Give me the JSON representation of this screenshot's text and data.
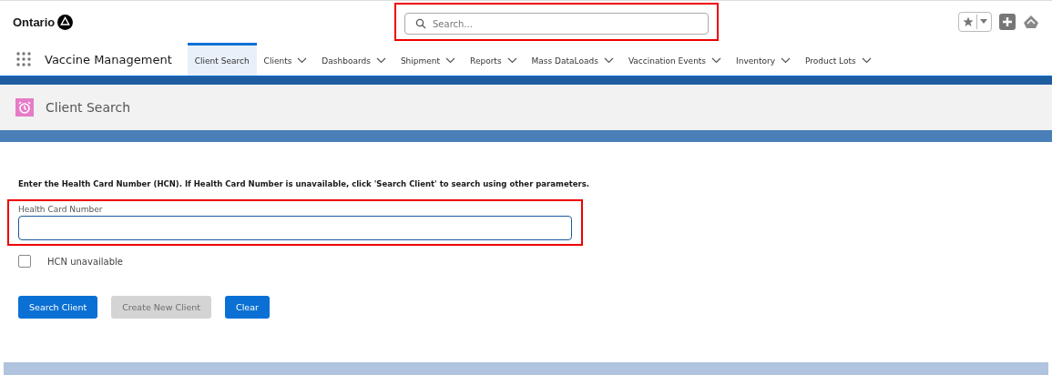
{
  "header": {
    "logo": "Ontario",
    "search": {
      "placeholder": "Search...",
      "highlighted": true
    }
  },
  "nav": {
    "app_name": "Vaccine Management",
    "tabs": [
      {
        "label": "Client Search",
        "selected": true,
        "dropdown": false
      },
      {
        "label": "Clients",
        "selected": false,
        "dropdown": true
      },
      {
        "label": "Dashboards",
        "selected": false,
        "dropdown": true
      },
      {
        "label": "Shipment",
        "selected": false,
        "dropdown": true
      },
      {
        "label": "Reports",
        "selected": false,
        "dropdown": true
      },
      {
        "label": "Mass DataLoads",
        "selected": false,
        "dropdown": true
      },
      {
        "label": "Vaccination Events",
        "selected": false,
        "dropdown": true
      },
      {
        "label": "Inventory",
        "selected": false,
        "dropdown": true
      },
      {
        "label": "Product Lots",
        "selected": false,
        "dropdown": true
      }
    ]
  },
  "page_header": {
    "title": "Client Search"
  },
  "form": {
    "instructions": "Enter the Health Card Number (HCN). If Health Card Number is unavailable, click 'Search Client' to search using other parameters.",
    "hcn_field": {
      "label": "Health Card Number",
      "highlighted": true
    },
    "hcn_unavailable": {
      "label": "HCN unavailable",
      "checked": false
    },
    "buttons": [
      {
        "label": "Search Client",
        "disabled": false
      },
      {
        "label": "Create New Client",
        "disabled": true
      },
      {
        "label": "Clear",
        "disabled": false
      }
    ]
  }
}
